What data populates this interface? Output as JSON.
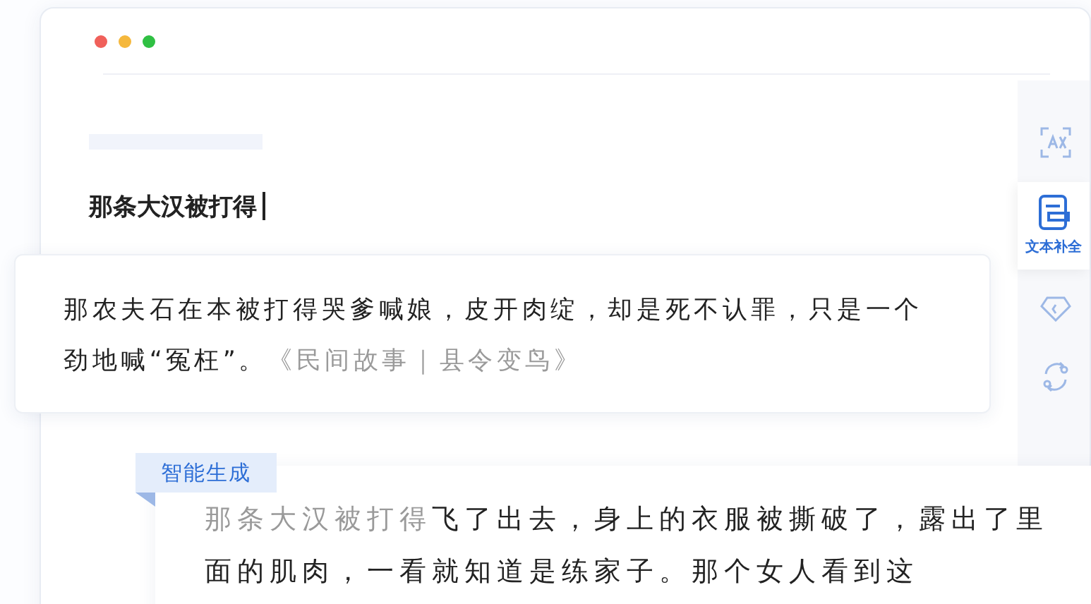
{
  "window": {
    "controls": [
      {
        "color": "#f0605a"
      },
      {
        "color": "#f5b83d"
      },
      {
        "color": "#2fc043"
      }
    ]
  },
  "editor": {
    "input": "那条大汉被打得"
  },
  "tools": [
    {
      "kind": "ocr",
      "selected": false
    },
    {
      "kind": "complete",
      "label": "文本补全",
      "selected": true
    },
    {
      "kind": "tag",
      "selected": false
    },
    {
      "kind": "convert",
      "selected": false
    }
  ],
  "suggestion": {
    "text": "那农夫石在本被打得哭爹喊娘，皮开肉绽，却是死不认罪，只是一个劲地喊“冤枉”。",
    "source": "《民间故事｜县令变鸟》"
  },
  "generated": {
    "tag": "智能生成",
    "prompt": "那条大汉被打得",
    "continuation": "飞了出去，身上的衣服被撕破了，露出了里面的肌肉，一看就知道是练家子。那个女人看到这"
  }
}
